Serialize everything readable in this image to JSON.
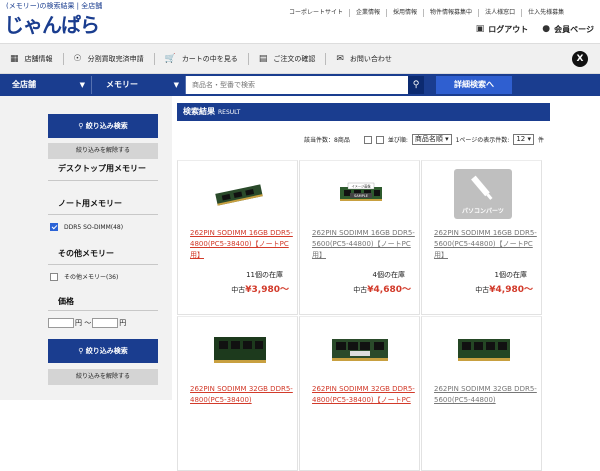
{
  "header": {
    "tagline": "(メモリー)の検索結果 | 全店舗",
    "logo": "じゃんぱら",
    "links": [
      "コーポレートサイト",
      "企業情報",
      "採用情報",
      "物件情報募集中",
      "法人様窓口",
      "仕入先様募集"
    ],
    "logout": "ログアウト",
    "member": "会員ページ"
  },
  "nav": {
    "items": [
      {
        "icon": "store-icon",
        "label": "店舗情報"
      },
      {
        "icon": "payment-icon",
        "label": "分割買取完済申請"
      },
      {
        "icon": "cart-icon",
        "label": "カートの中を見る"
      },
      {
        "icon": "document-icon",
        "label": "ご注文の確認"
      },
      {
        "icon": "mail-icon",
        "label": "お問い合わせ"
      }
    ]
  },
  "search": {
    "store": "全店舗",
    "category": "メモリー",
    "placeholder": "商品名・型番で検索",
    "advanced": "詳細検索へ"
  },
  "sidebar": {
    "filter_button": "絞り込み検索",
    "clear_button": "絞り込みを解除する",
    "categories": [
      {
        "title": "デスクトップ用メモリー"
      },
      {
        "title": "ノート用メモリー",
        "option": "DDR5 SO-DIMM(48)",
        "checked": true
      },
      {
        "title": "その他メモリー",
        "option": "その他メモリー(36)",
        "checked": false
      },
      {
        "title": "価格"
      }
    ],
    "price_sep": "円 〜",
    "price_unit": "円"
  },
  "results": {
    "title": "検索結果",
    "subtitle": "RESULT",
    "count_text": "該当件数：8商品",
    "sort_label": "並び順:",
    "sort_value": "商品名順",
    "perpage_label": "1ページの表示件数:",
    "perpage_value": "12",
    "perpage_unit": "件",
    "products": [
      {
        "title": "262PIN SODIMM 16GB DDR5-4800(PC5-38400)【ノートPC用】",
        "title_style": "red",
        "stock": "11個の在庫",
        "cond": "中古",
        "price": "¥3,980〜",
        "image": "memory-photo"
      },
      {
        "title": "262PIN SODIMM 16GB DDR5-5600(PC5-44800)【ノートPC用】",
        "title_style": "gray",
        "stock": "4個の在庫",
        "cond": "中古",
        "price": "¥4,680〜",
        "image": "sample-photo",
        "image_text": [
          "イメージ画像",
          "SAMPLE"
        ]
      },
      {
        "title": "262PIN SODIMM 16GB DDR5-5600(PC5-44800)【ノートPC用】",
        "title_style": "gray",
        "stock": "1個の在庫",
        "cond": "中古",
        "price": "¥4,980〜",
        "image": "pc-parts-placeholder",
        "image_text": [
          "パソコンパーツ"
        ]
      },
      {
        "title": "262PIN SODIMM 32GB DDR5-4800(PC5-38400)",
        "title_style": "red",
        "image": "memory-photo"
      },
      {
        "title": "262PIN SODIMM 32GB DDR5-4800(PC5-38400)【ノートPC",
        "title_style": "red",
        "image": "memory-photo"
      },
      {
        "title": "262PIN SODIMM 32GB DDR5-5600(PC5-44800)",
        "title_style": "gray",
        "image": "memory-photo"
      }
    ]
  }
}
